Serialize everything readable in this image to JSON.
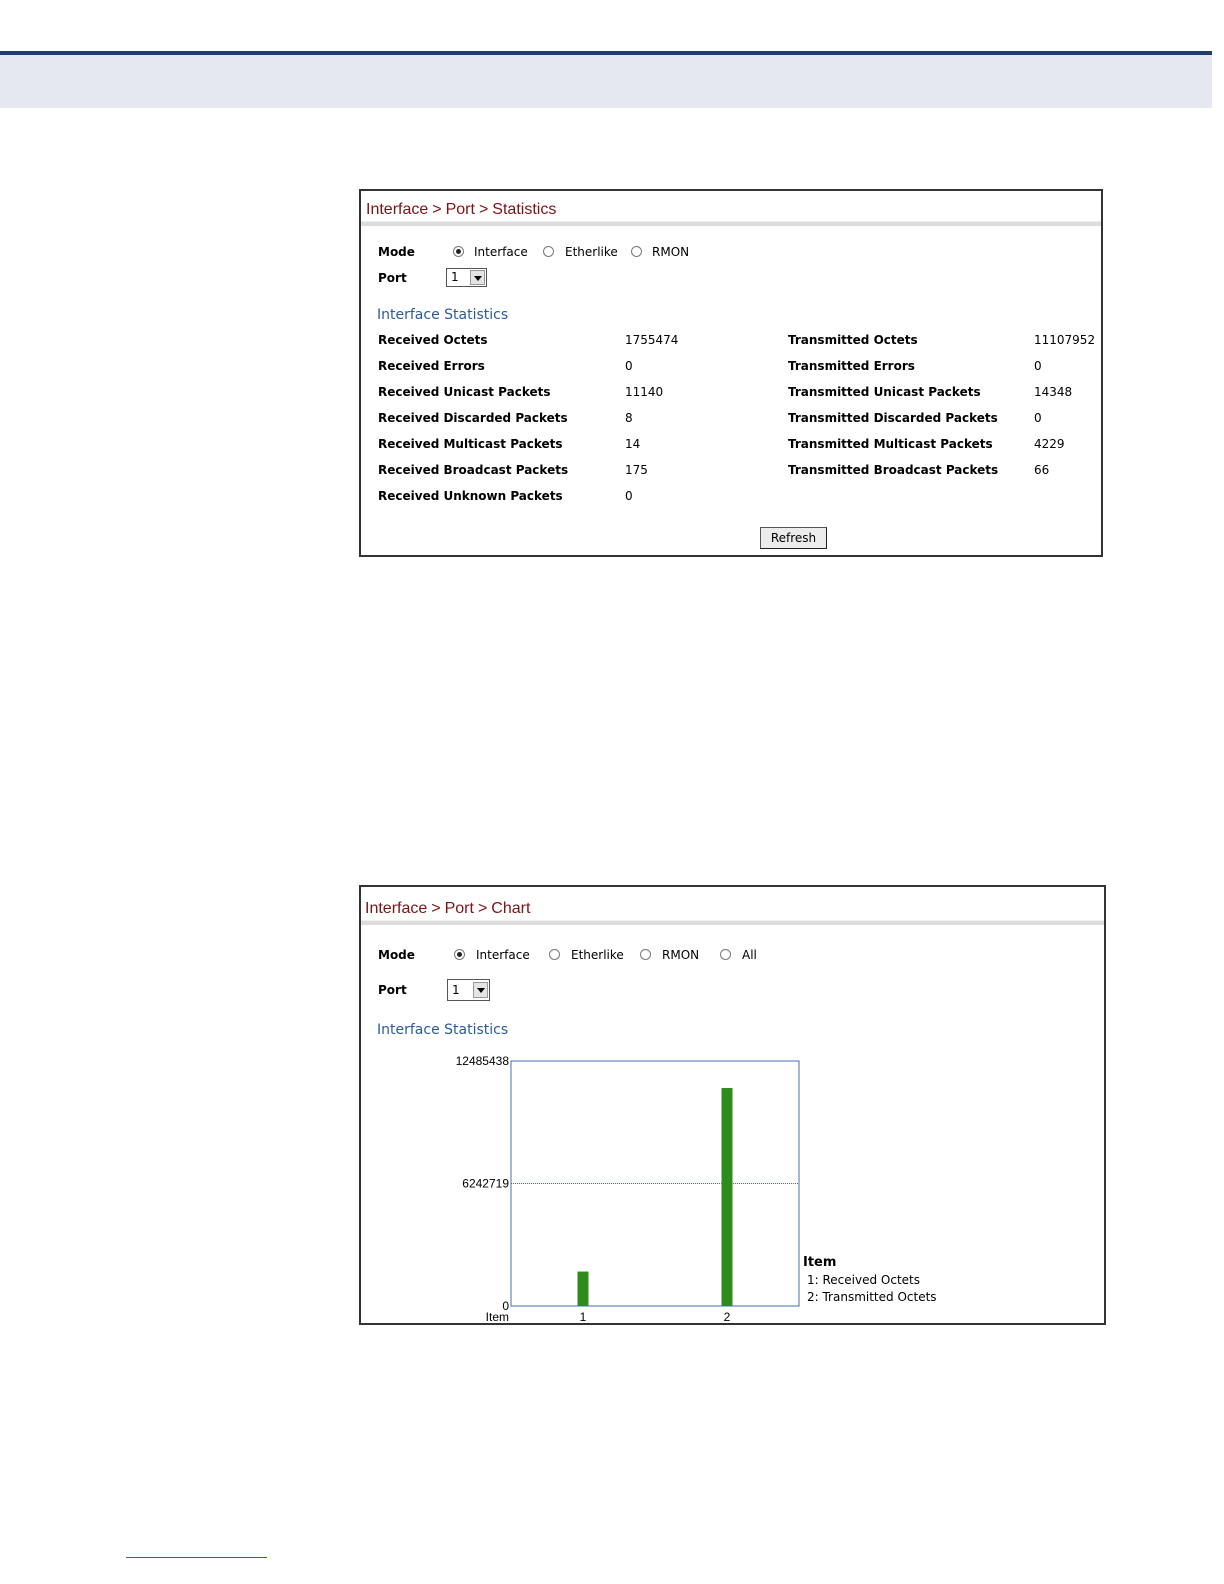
{
  "stats_panel": {
    "breadcrumb": [
      "Interface",
      "Port",
      "Statistics"
    ],
    "mode_label": "Mode",
    "modes": [
      {
        "label": "Interface",
        "selected": true
      },
      {
        "label": "Etherlike",
        "selected": false
      },
      {
        "label": "RMON",
        "selected": false
      }
    ],
    "port_label": "Port",
    "port_value": "1",
    "section_title": "Interface Statistics",
    "received": [
      {
        "label": "Received Octets",
        "value": "1755474"
      },
      {
        "label": "Received Errors",
        "value": "0"
      },
      {
        "label": "Received Unicast Packets",
        "value": "11140"
      },
      {
        "label": "Received Discarded Packets",
        "value": "8"
      },
      {
        "label": "Received Multicast Packets",
        "value": "14"
      },
      {
        "label": "Received Broadcast Packets",
        "value": "175"
      },
      {
        "label": "Received Unknown Packets",
        "value": "0"
      }
    ],
    "transmitted": [
      {
        "label": "Transmitted Octets",
        "value": "11107952"
      },
      {
        "label": "Transmitted Errors",
        "value": "0"
      },
      {
        "label": "Transmitted Unicast Packets",
        "value": "14348"
      },
      {
        "label": "Transmitted Discarded Packets",
        "value": "0"
      },
      {
        "label": "Transmitted Multicast Packets",
        "value": "4229"
      },
      {
        "label": "Transmitted Broadcast Packets",
        "value": "66"
      }
    ],
    "refresh_label": "Refresh"
  },
  "chart_panel": {
    "breadcrumb": [
      "Interface",
      "Port",
      "Chart"
    ],
    "mode_label": "Mode",
    "modes": [
      {
        "label": "Interface",
        "selected": true
      },
      {
        "label": "Etherlike",
        "selected": false
      },
      {
        "label": "RMON",
        "selected": false
      },
      {
        "label": "All",
        "selected": false
      }
    ],
    "port_label": "Port",
    "port_value": "1",
    "section_title": "Interface Statistics",
    "legend_title": "Item",
    "legend_items": [
      "1: Received Octets",
      "2: Transmitted Octets"
    ]
  },
  "chart_data": {
    "type": "bar",
    "categories": [
      "1",
      "2"
    ],
    "values": [
      1755474,
      11107952
    ],
    "xlabel": "Item",
    "ylabel": "",
    "ylim": [
      0,
      12485438
    ],
    "yticks": [
      "0",
      "6242719",
      "12485438"
    ],
    "midline": 6242719,
    "bar_color": "#2e8b1e",
    "midline_color": "#d04040",
    "axis_color": "#4a6fb0"
  },
  "colors": {
    "title": "#7b1416",
    "section": "#2a5b9c",
    "band": "#e6e8ef",
    "rule": "#1f3d6e"
  }
}
